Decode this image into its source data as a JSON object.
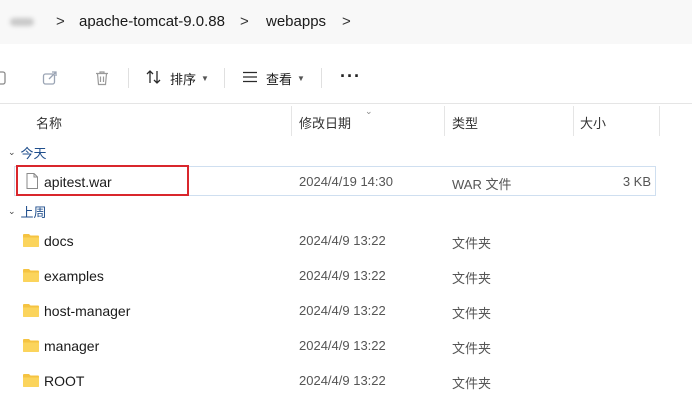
{
  "breadcrumb": {
    "items": [
      "apache-tomcat-9.0.88",
      "webapps"
    ],
    "separator": ">"
  },
  "toolbar": {
    "sort_label": "排序",
    "view_label": "查看",
    "more_label": "···",
    "icons": [
      "copy-icon",
      "share-icon",
      "delete-icon",
      "sort-icon",
      "view-icon",
      "more-icon"
    ]
  },
  "columns": {
    "name": "名称",
    "date": "修改日期",
    "type": "类型",
    "size": "大小"
  },
  "groups": [
    {
      "label": "今天",
      "items": [
        {
          "name": "apitest.war",
          "date": "2024/4/19 14:30",
          "type": "WAR 文件",
          "size": "3 KB",
          "icon": "file-icon"
        }
      ]
    },
    {
      "label": "上周",
      "items": [
        {
          "name": "docs",
          "date": "2024/4/9 13:22",
          "type": "文件夹",
          "size": "",
          "icon": "folder-icon"
        },
        {
          "name": "examples",
          "date": "2024/4/9 13:22",
          "type": "文件夹",
          "size": "",
          "icon": "folder-icon"
        },
        {
          "name": "host-manager",
          "date": "2024/4/9 13:22",
          "type": "文件夹",
          "size": "",
          "icon": "folder-icon"
        },
        {
          "name": "manager",
          "date": "2024/4/9 13:22",
          "type": "文件夹",
          "size": "",
          "icon": "folder-icon"
        },
        {
          "name": "ROOT",
          "date": "2024/4/9 13:22",
          "type": "文件夹",
          "size": "",
          "icon": "folder-icon"
        }
      ]
    }
  ],
  "colors": {
    "highlight": "#d9262c",
    "folder": "#f5c342",
    "group_label": "#1f4e8c"
  }
}
